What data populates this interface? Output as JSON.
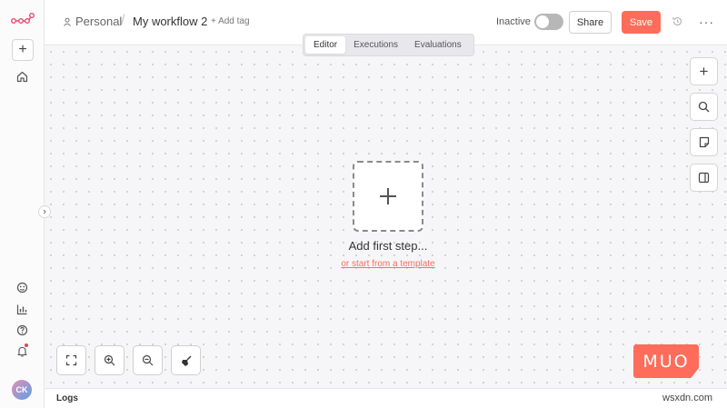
{
  "header": {
    "project": "Personal",
    "separator": "/",
    "workflow_name": "My workflow 2",
    "add_tag": "+ Add tag",
    "status": "Inactive",
    "share": "Share",
    "save": "Save",
    "more": "···"
  },
  "tabs": [
    {
      "label": "Editor",
      "active": true
    },
    {
      "label": "Executions",
      "active": false
    },
    {
      "label": "Evaluations",
      "active": false
    }
  ],
  "canvas": {
    "add_first_step": "Add first step...",
    "template_link": "or start from a template"
  },
  "sidebar": {
    "avatar_initials": "CK"
  },
  "logs": {
    "label": "Logs"
  },
  "watermark": {
    "brand": "MUO",
    "site": "wsxdn.com"
  },
  "colors": {
    "accent": "#ff6d5a",
    "toggle_off": "#b7b7b7"
  }
}
